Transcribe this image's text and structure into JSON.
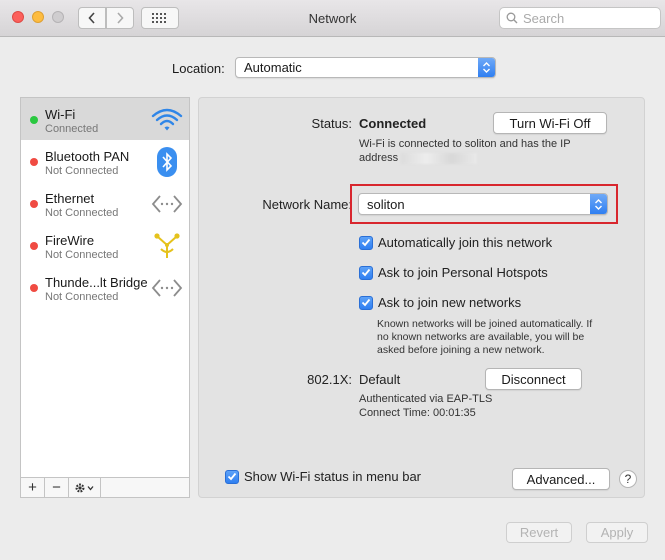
{
  "window": {
    "title": "Network"
  },
  "search": {
    "placeholder": "Search"
  },
  "location": {
    "label": "Location:",
    "value": "Automatic"
  },
  "services": [
    {
      "name": "Wi-Fi",
      "status": "Connected",
      "status_color": "#2ac840",
      "icon": "wifi-icon",
      "selected": true
    },
    {
      "name": "Bluetooth PAN",
      "status": "Not Connected",
      "status_color": "#f04b42",
      "icon": "bluetooth-icon"
    },
    {
      "name": "Ethernet",
      "status": "Not Connected",
      "status_color": "#f04b42",
      "icon": "ethernet-icon"
    },
    {
      "name": "FireWire",
      "status": "Not Connected",
      "status_color": "#f04b42",
      "icon": "firewire-icon"
    },
    {
      "name": "Thunde...lt Bridge",
      "status": "Not Connected",
      "status_color": "#f04b42",
      "icon": "thunderbolt-bridge-icon"
    }
  ],
  "sidebar_tools": {
    "add": "+",
    "remove": "−"
  },
  "status": {
    "label": "Status:",
    "value": "Connected",
    "description": "Wi-Fi is connected to soliton and has the IP",
    "description_2": "address",
    "turn_off_button": "Turn Wi-Fi Off"
  },
  "network_name": {
    "label": "Network Name:",
    "value": "soliton"
  },
  "options": {
    "auto_join": "Automatically join this network",
    "personal_hotspots": "Ask to join Personal Hotspots",
    "new_networks": "Ask to join new networks",
    "note_1": "Known networks will be joined automatically. If",
    "note_2": "no known networks are available, you will be",
    "note_3": "asked before joining a new network."
  },
  "dot1x": {
    "label": "802.1X:",
    "value": "Default",
    "disconnect_button": "Disconnect",
    "auth": "Authenticated via EAP-TLS",
    "connect_time": "Connect Time: 00:01:35"
  },
  "menu_bar_option": "Show Wi-Fi status in menu bar",
  "advanced_button": "Advanced...",
  "help": "?",
  "revert_button": "Revert",
  "apply_button": "Apply",
  "colors": {
    "accent": "#2f7ff1",
    "highlight_border": "#d8262e"
  }
}
